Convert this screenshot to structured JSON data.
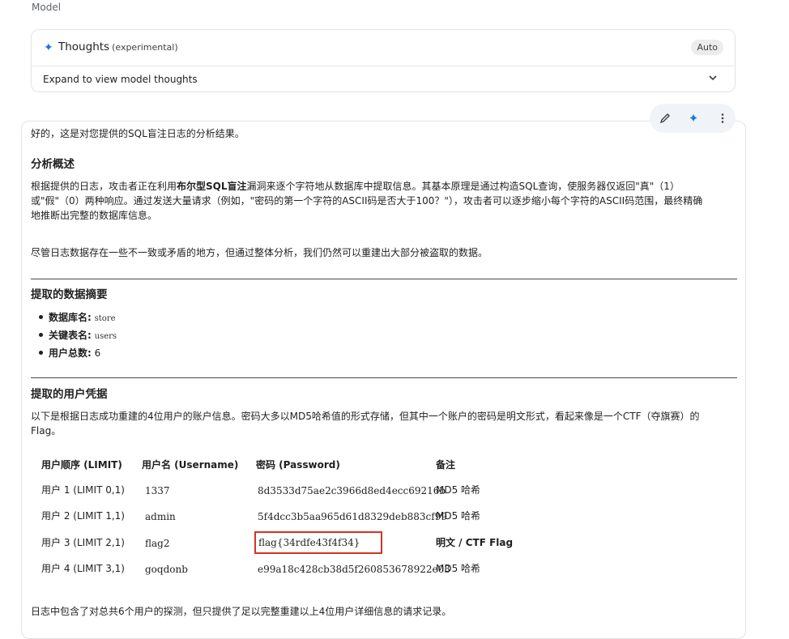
{
  "model_label": "Model",
  "thoughts": {
    "title": "Thoughts",
    "subtitle": "(experimental)",
    "badge": "Auto",
    "expand_label": "Expand to view model thoughts"
  },
  "toolbar": {
    "edit_icon": "pencil-icon",
    "sparkle_icon": "sparkle-icon",
    "more_icon": "more-vertical-icon"
  },
  "response": {
    "intro": "好的，这是对您提供的SQL盲注日志的分析结果。",
    "h_overview": "分析概述",
    "overview_p1_a": "根据提供的日志，攻击者正在利用",
    "overview_p1_bold": "布尔型SQL盲注",
    "overview_p1_b": "漏洞来逐个字符地从数据库中提取信息。其基本原理是通过构造SQL查询，使服务器仅返回\"真\"（1）",
    "overview_p1_line2": "或\"假\"（0）两种响应。通过发送大量请求（例如，\"密码的第一个字符的ASCII码是否大于100？\"），攻击者可以逐步缩小每个字符的ASCII码范围，最终精确",
    "overview_p1_line3": "地推断出完整的数据库信息。",
    "overview_p2": "尽管日志数据存在一些不一致或矛盾的地方，但通过整体分析，我们仍然可以重建出大部分被盗取的数据。",
    "h_summary": "提取的数据摘要",
    "summary": [
      {
        "label": "数据库名:",
        "value": "store"
      },
      {
        "label": "关键表名:",
        "value": "users"
      },
      {
        "label": "用户总数:",
        "value": "6"
      }
    ],
    "h_creds": "提取的用户凭据",
    "creds_p_line1": "以下是根据日志成功重建的4位用户的账户信息。密码大多以MD5哈希值的形式存储，但其中一个账户的密码是明文形式，看起来像是一个CTF（夺旗赛）的",
    "creds_p_line2": "Flag。",
    "table": {
      "headers": [
        "用户顺序 (LIMIT)",
        "用户名 (Username)",
        "密码 (Password)",
        "备注"
      ],
      "rows": [
        [
          "用户 1 (LIMIT 0,1)",
          "1337",
          "8d3533d75ae2c3966d8ed4ecc69216b",
          "MD5 哈希"
        ],
        [
          "用户 2 (LIMIT 1,1)",
          "admin",
          "5f4dcc3b5aa965d61d8329deb883cf99",
          "MD5 哈希"
        ],
        [
          "用户 3 (LIMIT 2,1)",
          "flag2",
          "flag{34rdfe43f4f34}",
          "明文 / CTF Flag"
        ],
        [
          "用户 4 (LIMIT 3,1)",
          "goqdonb",
          "e99a18c428cb38d5f260853678922e03",
          "MD5 哈希"
        ]
      ]
    },
    "footer": "日志中包含了对总共6个用户的探测，但只提供了足以完整重建以上4位用户详细信息的请求记录。"
  },
  "colors": {
    "accent": "#1a73e8",
    "highlight_box": "#d93025",
    "rule": "#4a4a4a"
  }
}
